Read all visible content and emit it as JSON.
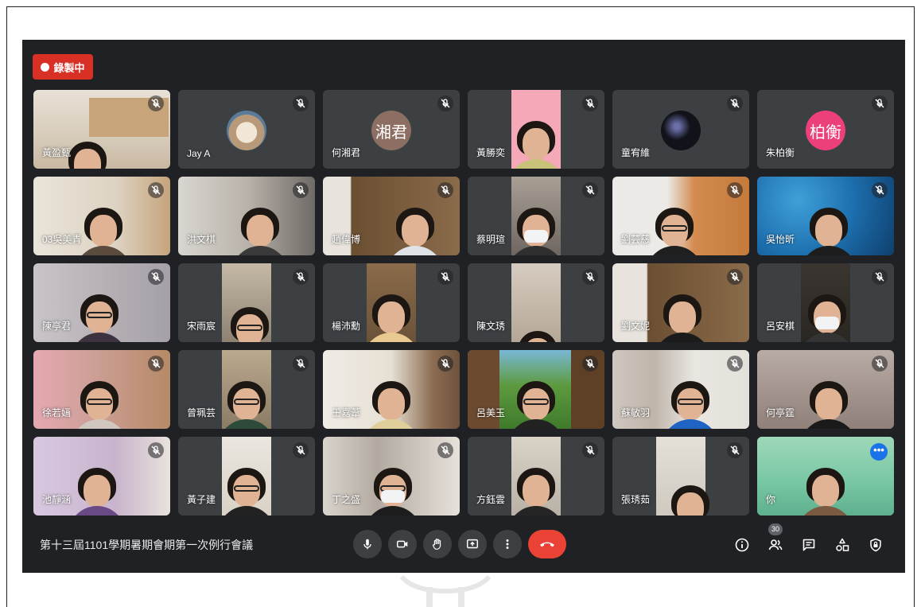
{
  "recording_label": "錄製中",
  "meeting_title": "第十三屆1101學期暑期會期第一次例行會議",
  "participant_count": "30",
  "participants": [
    {
      "name": "黃盈甄"
    },
    {
      "name": "Jay A"
    },
    {
      "name": "何湘君"
    },
    {
      "name": "黃勝奕"
    },
    {
      "name": "童宥維"
    },
    {
      "name": "朱柏衡"
    },
    {
      "name": "03吳美青"
    },
    {
      "name": "洪文棋"
    },
    {
      "name": "趙偉博"
    },
    {
      "name": "蔡明瑄"
    },
    {
      "name": "劉芸慈"
    },
    {
      "name": "吳怡昕"
    },
    {
      "name": "陳亭君"
    },
    {
      "name": "宋雨宸"
    },
    {
      "name": "楊沛勳"
    },
    {
      "name": "陳文琇"
    },
    {
      "name": "劉文妮"
    },
    {
      "name": "呂安棋"
    },
    {
      "name": "徐若婳"
    },
    {
      "name": "曾珮芸"
    },
    {
      "name": "王嘉葦"
    },
    {
      "name": "呂美玉"
    },
    {
      "name": "蘇敏羽"
    },
    {
      "name": "何亭霆"
    },
    {
      "name": "池靜涵"
    },
    {
      "name": "黃子建"
    },
    {
      "name": "丁之盛"
    },
    {
      "name": "方鈺雲"
    },
    {
      "name": "張琇茹"
    },
    {
      "name": "你"
    }
  ],
  "avatars": {
    "hexiangjun": {
      "initials": "湘君",
      "color": "#8d6e63"
    },
    "zhubaiheng": {
      "initials": "柏衡",
      "color": "#ec407a"
    }
  },
  "controls": [
    "mic-icon",
    "camera-icon",
    "raise-hand-icon",
    "present-icon",
    "more-options-icon",
    "hangup-icon"
  ],
  "right_icons": [
    "info-icon",
    "people-icon",
    "chat-icon",
    "activities-icon",
    "host-controls-icon"
  ],
  "colors": {
    "background": "#202124",
    "tile": "#3c4043",
    "record": "#d93025",
    "hangup": "#ea4335",
    "self_outline": "#8ab4f8"
  }
}
